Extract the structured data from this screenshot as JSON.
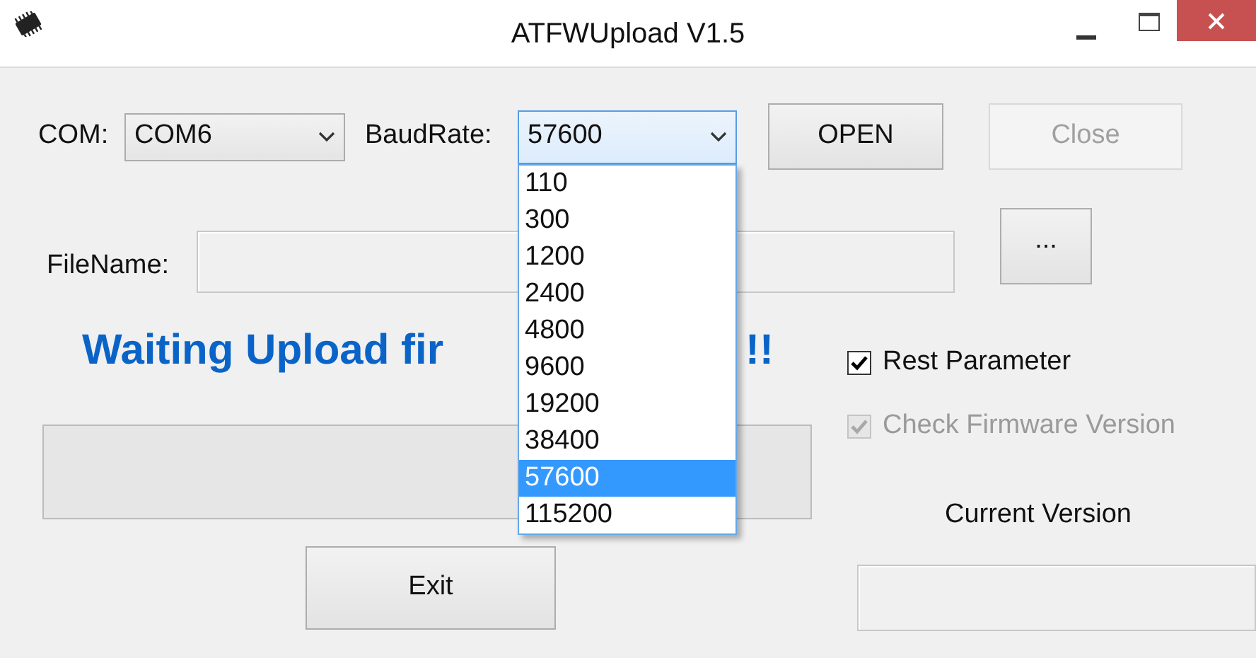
{
  "window": {
    "title": "ATFWUpload V1.5"
  },
  "com": {
    "label": "COM:",
    "value": "COM6"
  },
  "baud": {
    "label": "BaudRate:",
    "value": "57600",
    "expanded": true,
    "options": [
      {
        "label": "110",
        "selected": false
      },
      {
        "label": "300",
        "selected": false
      },
      {
        "label": "1200",
        "selected": false
      },
      {
        "label": "2400",
        "selected": false
      },
      {
        "label": "4800",
        "selected": false
      },
      {
        "label": "9600",
        "selected": false
      },
      {
        "label": "19200",
        "selected": false
      },
      {
        "label": "38400",
        "selected": false
      },
      {
        "label": "57600",
        "selected": true
      },
      {
        "label": "115200",
        "selected": false
      }
    ]
  },
  "buttons": [
    {
      "label": "OPEN",
      "disabled": false
    },
    {
      "label": "Close",
      "disabled": true
    }
  ],
  "file": {
    "label": "FileName:",
    "browse": "..."
  },
  "status": [
    "Waiting Upload fir",
    "!!"
  ],
  "progress": {
    "level": 0
  },
  "exit": {
    "label": "Exit",
    "disabled": false
  },
  "checkboxes": [
    {
      "label": "Rest Parameter",
      "checked": true,
      "disabled": false
    },
    {
      "label": "Check Firmware Version",
      "checked": true,
      "disabled": true
    }
  ],
  "current_version": {
    "label": "Current Version"
  }
}
